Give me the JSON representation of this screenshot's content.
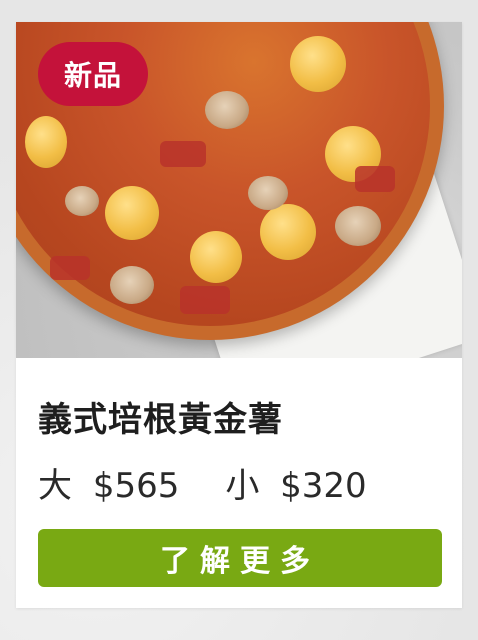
{
  "product": {
    "badge": "新品",
    "name": "義式培根黃金薯",
    "prices": [
      {
        "size": "大",
        "amount": "$565"
      },
      {
        "size": "小",
        "amount": "$320"
      }
    ],
    "cta_label": "了解更多"
  },
  "colors": {
    "badge": "#c4123a",
    "cta": "#79a913"
  }
}
